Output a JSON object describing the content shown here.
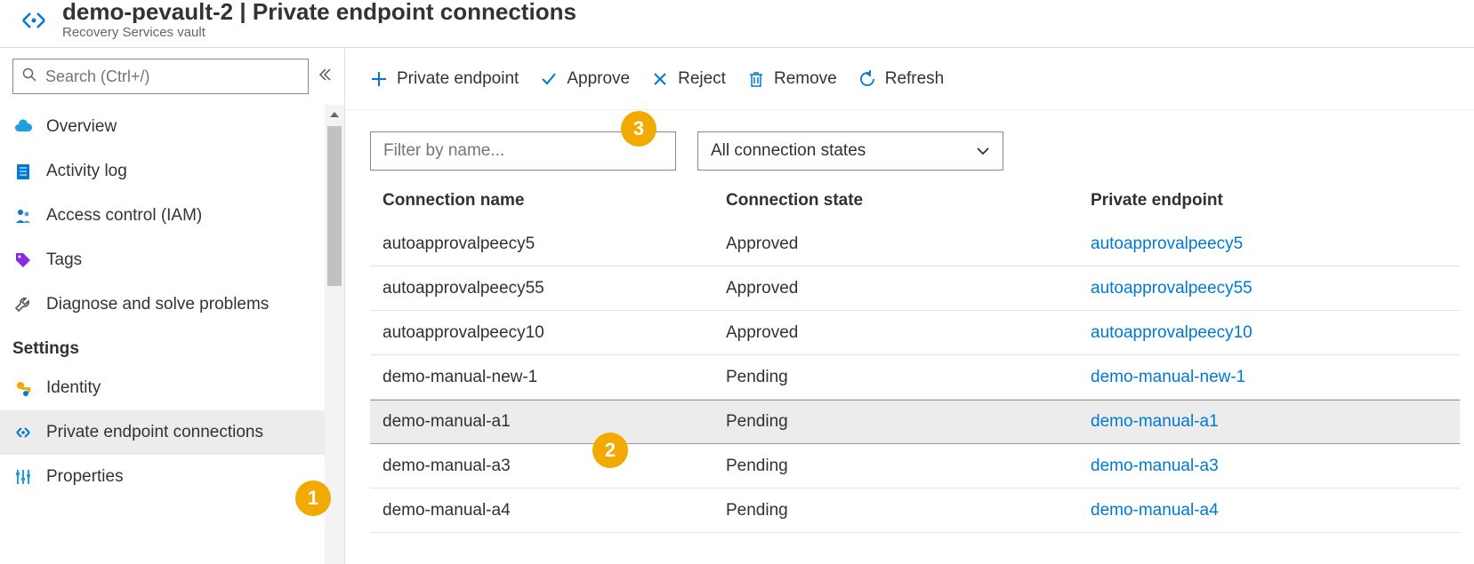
{
  "header": {
    "title": "demo-pevault-2 | Private endpoint connections",
    "subtitle": "Recovery Services vault"
  },
  "sidebar": {
    "search_placeholder": "Search (Ctrl+/)",
    "items_top": [
      {
        "label": "Overview",
        "icon": "cloud"
      },
      {
        "label": "Activity log",
        "icon": "log"
      },
      {
        "label": "Access control (IAM)",
        "icon": "people"
      },
      {
        "label": "Tags",
        "icon": "tag"
      },
      {
        "label": "Diagnose and solve problems",
        "icon": "wrench"
      }
    ],
    "section_label": "Settings",
    "items_settings": [
      {
        "label": "Identity",
        "icon": "key"
      },
      {
        "label": "Private endpoint connections",
        "icon": "endpoint",
        "active": true
      },
      {
        "label": "Properties",
        "icon": "sliders"
      }
    ]
  },
  "toolbar": {
    "add_label": "Private endpoint",
    "approve_label": "Approve",
    "reject_label": "Reject",
    "remove_label": "Remove",
    "refresh_label": "Refresh"
  },
  "filters": {
    "name_placeholder": "Filter by name...",
    "state_label": "All connection states"
  },
  "table": {
    "headers": {
      "name": "Connection name",
      "state": "Connection state",
      "endpoint": "Private endpoint"
    },
    "rows": [
      {
        "name": "autoapprovalpeecy5",
        "state": "Approved",
        "endpoint": "autoapprovalpeecy5"
      },
      {
        "name": "autoapprovalpeecy55",
        "state": "Approved",
        "endpoint": "autoapprovalpeecy55"
      },
      {
        "name": "autoapprovalpeecy10",
        "state": "Approved",
        "endpoint": "autoapprovalpeecy10"
      },
      {
        "name": "demo-manual-new-1",
        "state": "Pending",
        "endpoint": "demo-manual-new-1"
      },
      {
        "name": "demo-manual-a1",
        "state": "Pending",
        "endpoint": "demo-manual-a1",
        "selected": true
      },
      {
        "name": "demo-manual-a3",
        "state": "Pending",
        "endpoint": "demo-manual-a3"
      },
      {
        "name": "demo-manual-a4",
        "state": "Pending",
        "endpoint": "demo-manual-a4"
      }
    ]
  },
  "callouts": {
    "c1": "1",
    "c2": "2",
    "c3": "3"
  }
}
